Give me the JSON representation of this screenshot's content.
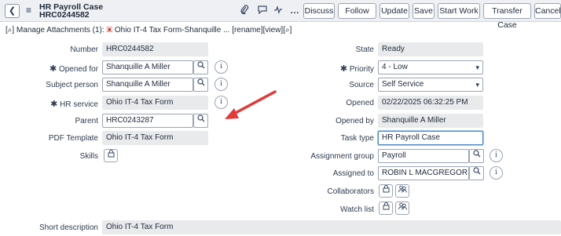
{
  "header": {
    "title_line1": "HR Payroll Case",
    "title_line2": "HRC0244582",
    "buttons": [
      "Discuss",
      "Follow",
      "Update",
      "Save",
      "Start Work",
      "Transfer Case",
      "Cancel"
    ]
  },
  "attachments": {
    "text": "[⌕] Manage Attachments (1):",
    "file_name": "Ohio IT-4 Tax Form-Shanquille ...",
    "actions": "[rename][view][⌕]"
  },
  "left_fields": {
    "number_label": "Number",
    "number_value": "HRC0244582",
    "opened_for_label": "Opened for",
    "opened_for_value": "Shanquille A Miller",
    "subject_label": "Subject person",
    "subject_value": "Shanquille A Miller",
    "hr_service_label": "HR service",
    "hr_service_value": "Ohio IT-4 Tax Form",
    "parent_label": "Parent",
    "parent_value": "HRC0243287",
    "pdf_label": "PDF Template",
    "pdf_value": "Ohio IT-4 Tax Form",
    "skills_label": "Skills",
    "short_desc_label": "Short description",
    "short_desc_value": "Ohio IT-4 Tax Form"
  },
  "right_fields": {
    "state_label": "State",
    "state_value": "Ready",
    "priority_label": "Priority",
    "priority_value": "4 - Low",
    "source_label": "Source",
    "source_value": "Self Service",
    "opened_label": "Opened",
    "opened_value": "02/22/2025 06:32:25 PM",
    "opened_by_label": "Opened by",
    "opened_by_value": "Shanquille A Miller",
    "task_type_label": "Task type",
    "task_type_value": "HR Payroll Case",
    "assignment_group_label": "Assignment group",
    "assignment_group_value": "Payroll",
    "assigned_to_label": "Assigned to",
    "assigned_to_value": "ROBIN L MACGREGOR",
    "collaborators_label": "Collaborators",
    "watch_list_label": "Watch list"
  },
  "icons": {
    "required": "✱",
    "search": "⚲",
    "info": "i",
    "lock": "⊟",
    "add_people": "⚇",
    "paperclip": "⌒",
    "chat": "⌕",
    "activity": "☲",
    "more": "…",
    "caret": "▾",
    "back": "❮",
    "menu": "≡",
    "pdf": "▣"
  },
  "annotation_color": "#e03a3a"
}
